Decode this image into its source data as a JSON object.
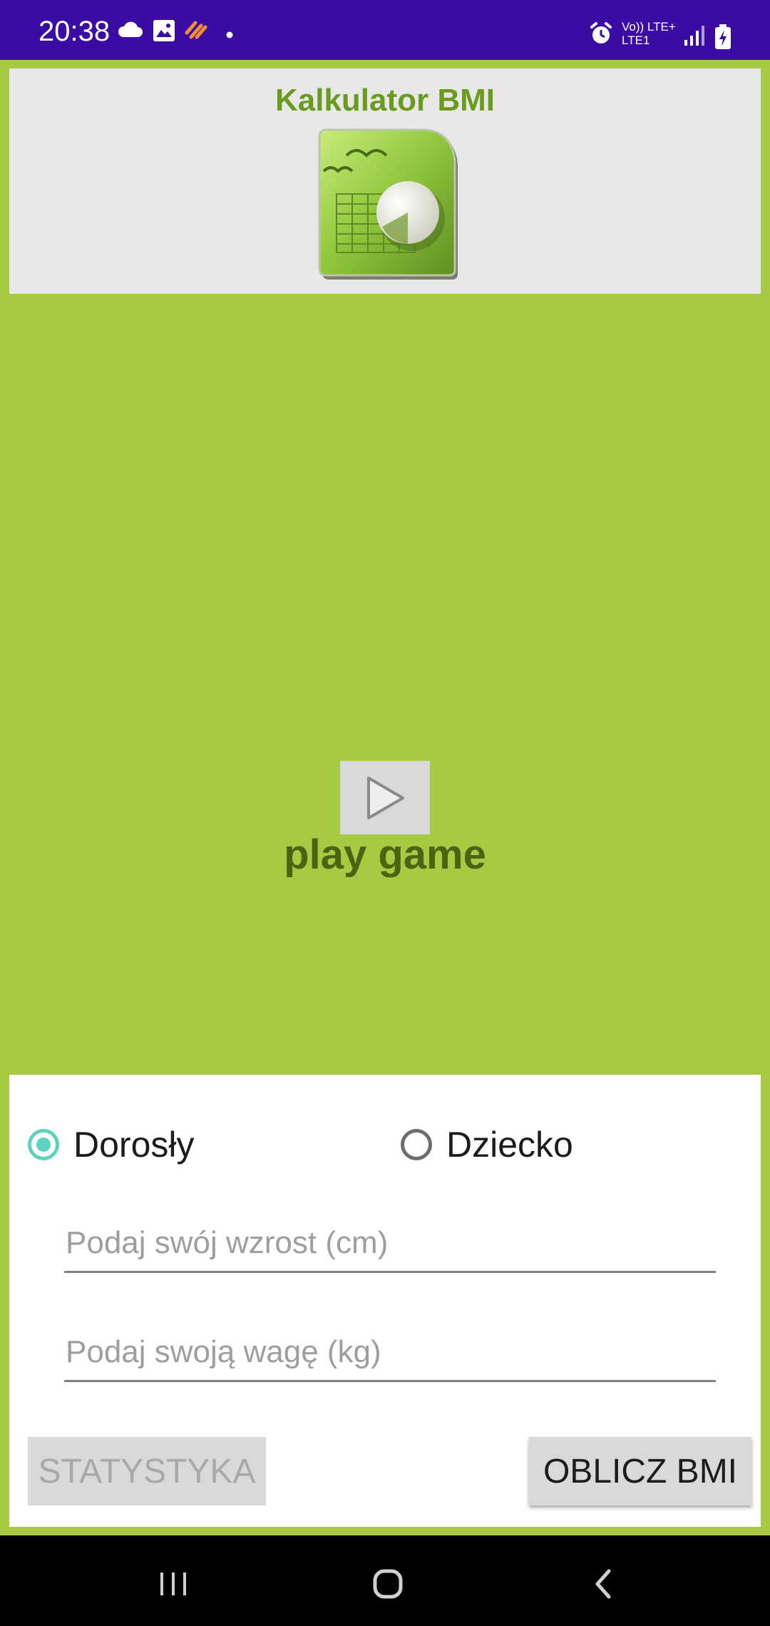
{
  "status_bar": {
    "time": "20:38",
    "left_icons": [
      "cloud-icon",
      "image-icon",
      "health-icon",
      "dot-icon"
    ],
    "right_icons": [
      "alarm-icon",
      "volte-icon",
      "signal-icon",
      "battery-charging-icon"
    ],
    "volte_top": "Vo)) LTE+",
    "volte_bottom": "LTE1"
  },
  "header": {
    "title": "Kalkulator BMI",
    "logo_icon": "spreadsheet-chart-logo-icon"
  },
  "video": {
    "play_icon": "play-icon",
    "label": "play game"
  },
  "form": {
    "radio_adult": {
      "label": "Dorosły",
      "checked": true
    },
    "radio_child": {
      "label": "Dziecko",
      "checked": false
    },
    "height_input": {
      "value": "",
      "placeholder": "Podaj swój wzrost (cm)"
    },
    "weight_input": {
      "value": "",
      "placeholder": "Podaj swoją wagę (kg)"
    },
    "stats_button": "STATYSTYKA",
    "calc_button": "OBLICZ BMI"
  },
  "nav_bar": {
    "icons": [
      "recent-apps-icon",
      "home-icon",
      "back-icon"
    ]
  },
  "colors": {
    "status_bar": "#3a0ca3",
    "background": "#a6cb42",
    "title": "#6a9a1e",
    "radio_accent": "#5fd3c0"
  }
}
